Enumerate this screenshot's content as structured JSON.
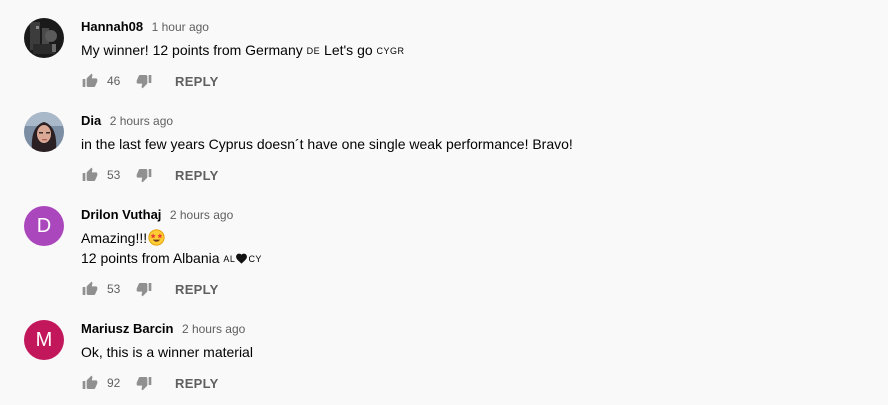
{
  "comments": [
    {
      "author": "Hannah08",
      "time": "1 hour ago",
      "text_parts": [
        "My winner! 12 points from Germany ",
        "DE",
        " Let's go ",
        "CYGR"
      ],
      "likes": "46",
      "reply_label": "REPLY"
    },
    {
      "author": "Dia",
      "time": "2 hours ago",
      "text": "in the last few years Cyprus doesn´t have one single weak performance! Bravo!",
      "likes": "53",
      "reply_label": "REPLY"
    },
    {
      "author": "Drilon Vuthaj",
      "time": "2 hours ago",
      "avatar_letter": "D",
      "avatar_color": "#ab47bc",
      "line1": "Amazing!!!",
      "line1_emoji": "star-struck-emoji",
      "line2": "12 points from Albania ",
      "line2_flag_1": "AL",
      "line2_flag_2": "CY",
      "line2_heart": "black-heart",
      "likes": "53",
      "reply_label": "REPLY"
    },
    {
      "author": "Mariusz Barcin",
      "time": "2 hours ago",
      "avatar_letter": "M",
      "avatar_color": "#c2185b",
      "text": "Ok, this is a winner material",
      "likes": "92",
      "reply_label": "REPLY"
    }
  ],
  "icons": {
    "like": "thumb-up-icon",
    "dislike": "thumb-down-icon"
  }
}
